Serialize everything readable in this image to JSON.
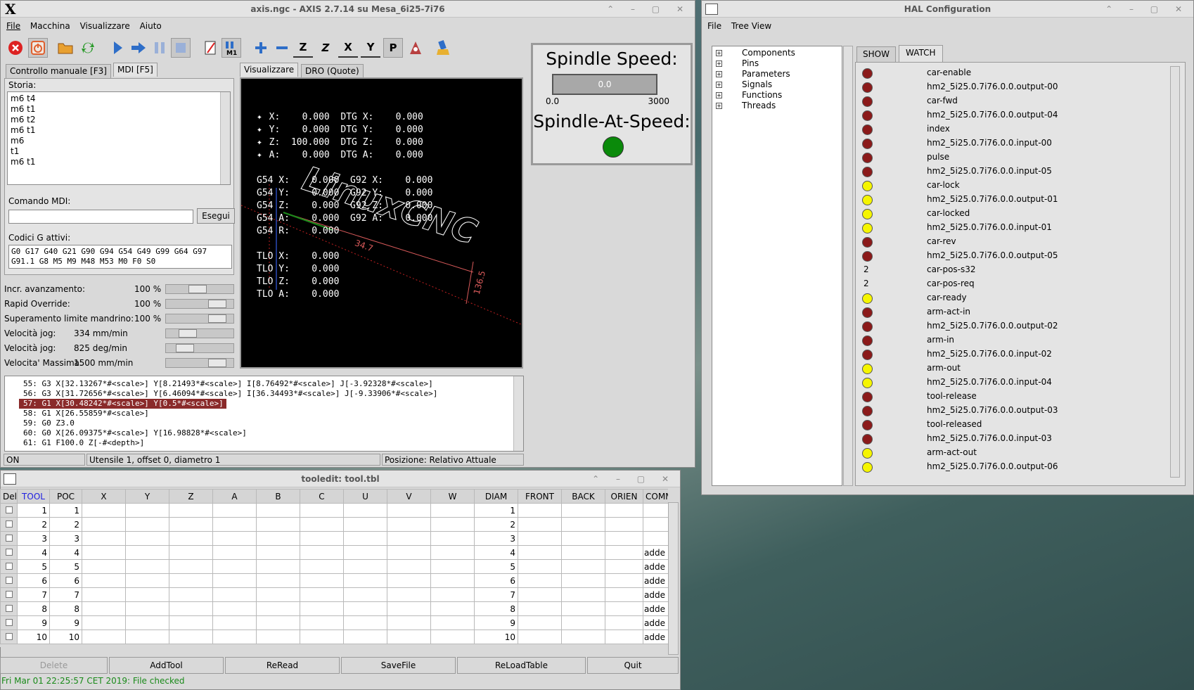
{
  "axis": {
    "title": "axis.ngc - AXIS 2.7.14 su Mesa_6i25-7i76",
    "menu": [
      "File",
      "Macchina",
      "Visualizzare",
      "Aiuto"
    ],
    "toolbar": {
      "icons": [
        "estop-icon",
        "power-icon",
        "open-icon",
        "reload-icon",
        "run-icon",
        "step-icon",
        "pause-icon",
        "stop-icon",
        "block-delete-icon",
        "optional-stop-icon",
        "zoom-in-icon",
        "zoom-out-icon",
        "view-z-icon",
        "view-z2-icon",
        "view-x-icon",
        "view-y-icon",
        "view-p-icon",
        "rotate-icon",
        "clear-plot-icon"
      ],
      "letters": {
        "z": "Z",
        "x": "X",
        "y": "Y",
        "p": "P"
      }
    },
    "tabs_left": [
      "Controllo manuale [F3]",
      "MDI [F5]"
    ],
    "storia_label": "Storia:",
    "history": [
      "m6 t4",
      "m6 t1",
      "m6 t2",
      "m6 t1",
      "m6",
      "t1",
      "m6 t1"
    ],
    "mdi_label": "Comando MDI:",
    "mdi_value": "",
    "exec_label": "Esegui",
    "gcodes_label": "Codici G attivi:",
    "gcodes": [
      "G0 G17 G40 G21 G90 G94 G54 G49 G99 G64 G97",
      "G91.1 G8 M5 M9 M48 M53 M0 F0 S0"
    ],
    "overrides": [
      {
        "label": "Incr. avanzamento:",
        "value": "100 %"
      },
      {
        "label": "Rapid Override:",
        "value": "100 %"
      },
      {
        "label": "Superamento limite mandrino:",
        "value": "100 %"
      },
      {
        "label": "Velocità jog:",
        "value": "334 mm/min"
      },
      {
        "label": "Velocità jog:",
        "value": "825 deg/min"
      },
      {
        "label": "Velocita' Massima:",
        "value": "1500 mm/min"
      }
    ],
    "override_levels": [
      0.45,
      0.85,
      0.85,
      0.25,
      0.2,
      0.85
    ],
    "tabs_view": [
      "Visualizzare",
      "DRO (Quote)"
    ],
    "dro": [
      " X:    0.000  DTG X:    0.000",
      " Y:    0.000  DTG Y:    0.000",
      " Z:  100.000  DTG Z:    0.000",
      " A:    0.000  DTG A:    0.000",
      "",
      "G54 X:    0.000  G92 X:    0.000",
      "G54 Y:    0.000  G92 Y:    0.000",
      "G54 Z:    0.000  G92 Z:    0.000",
      "G54 A:    0.000  G92 A:    0.000",
      "G54 R:    0.000",
      "",
      "TLO X:    0.000",
      "TLO Y:    0.000",
      "TLO Z:    0.000",
      "TLO A:    0.000"
    ],
    "plot": {
      "logo": "LinuxCNC",
      "dim1": "34.7",
      "dim2": "136.5"
    },
    "gcode_lines": [
      "55: G3 X[32.13267*#<scale>] Y[8.21493*#<scale>] I[8.76492*#<scale>] J[-3.92328*#<scale>]",
      "56: G3 X[31.72656*#<scale>] Y[6.46094*#<scale>] I[36.34493*#<scale>] J[-9.33906*#<scale>]",
      "57: G1 X[30.48242*#<scale>] Y[0.5*#<scale>]",
      "58: G1 X[26.55859*#<scale>]",
      "59: G0 Z3.0",
      "60: G0 X[26.09375*#<scale>] Y[16.98828*#<scale>]",
      "61: G1 F100.0 Z[-#<depth>]"
    ],
    "highlight_index": 2,
    "status": {
      "state": "ON",
      "tool": "Utensile 1, offset 0, diametro 1",
      "pos": "Posizione: Relativo Attuale"
    },
    "spindle": {
      "speed_label": "Spindle Speed:",
      "speed_value": "0.0",
      "min": "0.0",
      "max": "3000",
      "at_speed_label": "Spindle-At-Speed:",
      "at_speed_color": "#0a8a0a"
    }
  },
  "hal": {
    "title": "HAL Configuration",
    "menu": [
      "File",
      "Tree View"
    ],
    "tree": [
      "Components",
      "Pins",
      "Parameters",
      "Signals",
      "Functions",
      "Threads"
    ],
    "tabs": [
      "SHOW",
      "WATCH"
    ],
    "watch": [
      {
        "type": "led",
        "color": "#8b1a1a",
        "name": "car-enable"
      },
      {
        "type": "led",
        "color": "#8b1a1a",
        "name": "hm2_5i25.0.7i76.0.0.output-00"
      },
      {
        "type": "led",
        "color": "#8b1a1a",
        "name": "car-fwd"
      },
      {
        "type": "led",
        "color": "#8b1a1a",
        "name": "hm2_5i25.0.7i76.0.0.output-04"
      },
      {
        "type": "led",
        "color": "#8b1a1a",
        "name": "index"
      },
      {
        "type": "led",
        "color": "#8b1a1a",
        "name": "hm2_5i25.0.7i76.0.0.input-00"
      },
      {
        "type": "led",
        "color": "#8b1a1a",
        "name": "pulse"
      },
      {
        "type": "led",
        "color": "#8b1a1a",
        "name": "hm2_5i25.0.7i76.0.0.input-05"
      },
      {
        "type": "led",
        "color": "#f5f500",
        "name": "car-lock"
      },
      {
        "type": "led",
        "color": "#f5f500",
        "name": "hm2_5i25.0.7i76.0.0.output-01"
      },
      {
        "type": "led",
        "color": "#f5f500",
        "name": "car-locked"
      },
      {
        "type": "led",
        "color": "#f5f500",
        "name": "hm2_5i25.0.7i76.0.0.input-01"
      },
      {
        "type": "led",
        "color": "#8b1a1a",
        "name": "car-rev"
      },
      {
        "type": "led",
        "color": "#8b1a1a",
        "name": "hm2_5i25.0.7i76.0.0.output-05"
      },
      {
        "type": "num",
        "value": "2",
        "name": "car-pos-s32"
      },
      {
        "type": "num",
        "value": "2",
        "name": "car-pos-req"
      },
      {
        "type": "led",
        "color": "#f5f500",
        "name": "car-ready"
      },
      {
        "type": "led",
        "color": "#8b1a1a",
        "name": "arm-act-in"
      },
      {
        "type": "led",
        "color": "#8b1a1a",
        "name": "hm2_5i25.0.7i76.0.0.output-02"
      },
      {
        "type": "led",
        "color": "#8b1a1a",
        "name": "arm-in"
      },
      {
        "type": "led",
        "color": "#8b1a1a",
        "name": "hm2_5i25.0.7i76.0.0.input-02"
      },
      {
        "type": "led",
        "color": "#f5f500",
        "name": "arm-out"
      },
      {
        "type": "led",
        "color": "#f5f500",
        "name": "hm2_5i25.0.7i76.0.0.input-04"
      },
      {
        "type": "led",
        "color": "#8b1a1a",
        "name": "tool-release"
      },
      {
        "type": "led",
        "color": "#8b1a1a",
        "name": "hm2_5i25.0.7i76.0.0.output-03"
      },
      {
        "type": "led",
        "color": "#8b1a1a",
        "name": "tool-released"
      },
      {
        "type": "led",
        "color": "#8b1a1a",
        "name": "hm2_5i25.0.7i76.0.0.input-03"
      },
      {
        "type": "led",
        "color": "#f5f500",
        "name": "arm-act-out"
      },
      {
        "type": "led",
        "color": "#f5f500",
        "name": "hm2_5i25.0.7i76.0.0.output-06"
      }
    ]
  },
  "tooledit": {
    "title": "tooledit: tool.tbl",
    "columns": [
      "Del",
      "TOOL",
      "POC",
      "X",
      "Y",
      "Z",
      "A",
      "B",
      "C",
      "U",
      "V",
      "W",
      "DIAM",
      "FRONT",
      "BACK",
      "ORIEN",
      "COMME"
    ],
    "rows": [
      {
        "tool": "1",
        "poc": "1",
        "diam": "1",
        "comment": ""
      },
      {
        "tool": "2",
        "poc": "2",
        "diam": "2",
        "comment": ""
      },
      {
        "tool": "3",
        "poc": "3",
        "diam": "3",
        "comment": ""
      },
      {
        "tool": "4",
        "poc": "4",
        "diam": "4",
        "comment": "adde"
      },
      {
        "tool": "5",
        "poc": "5",
        "diam": "5",
        "comment": "adde"
      },
      {
        "tool": "6",
        "poc": "6",
        "diam": "6",
        "comment": "adde"
      },
      {
        "tool": "7",
        "poc": "7",
        "diam": "7",
        "comment": "adde"
      },
      {
        "tool": "8",
        "poc": "8",
        "diam": "8",
        "comment": "adde"
      },
      {
        "tool": "9",
        "poc": "9",
        "diam": "9",
        "comment": "adde"
      },
      {
        "tool": "10",
        "poc": "10",
        "diam": "10",
        "comment": "adde"
      }
    ],
    "buttons": [
      "Delete",
      "AddTool",
      "ReRead",
      "SaveFile",
      "ReLoadTable",
      "Quit"
    ],
    "status": "Fri Mar 01 22:25:57 CET 2019: File checked"
  }
}
